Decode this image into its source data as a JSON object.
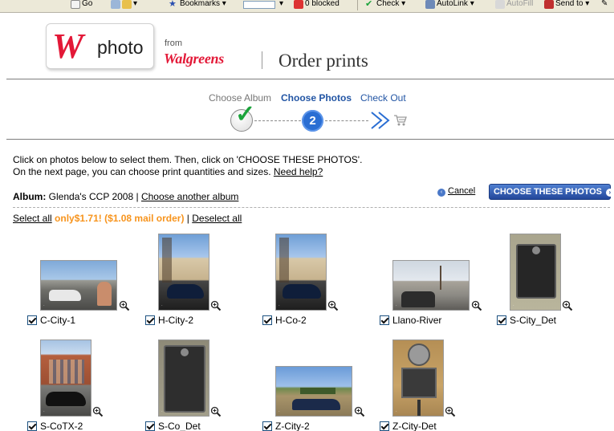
{
  "toolbar": {
    "items": [
      "Go",
      "Bookmarks",
      "0 blocked",
      "Check",
      "AutoLink",
      "AutoFill",
      "Send to"
    ]
  },
  "header": {
    "logo_letter": "W",
    "logo_word": "photo",
    "from": "from",
    "brand": "Walgreens",
    "title": "Order prints"
  },
  "steps": {
    "step1": "Choose Album",
    "step2": "Choose Photos",
    "step3": "Check Out",
    "current_number": "2"
  },
  "instructions": {
    "line1": "Click on photos below to select them. Then, click on 'CHOOSE THESE PHOTOS'.",
    "line2": "On the next page, you can choose print quantities and sizes.",
    "help_link": "Need help?"
  },
  "album": {
    "label": "Album:",
    "name": "Glenda's CCP 2008",
    "separator": "|",
    "change_link": "Choose another album"
  },
  "actions": {
    "cancel": "Cancel",
    "choose": "CHOOSE THESE PHOTOS"
  },
  "selection": {
    "select_all": "Select all",
    "price": "only$1.71! ($1.08 mail order)",
    "separator": "|",
    "deselect_all": "Deselect all"
  },
  "photos": [
    {
      "caption": "C-City-1",
      "checked": true
    },
    {
      "caption": "H-City-2",
      "checked": true
    },
    {
      "caption": "H-Co-2",
      "checked": true
    },
    {
      "caption": "Llano-River",
      "checked": true
    },
    {
      "caption": "S-City_Det",
      "checked": true
    },
    {
      "caption": "S-CoTX-2",
      "checked": true
    },
    {
      "caption": "S-Co_Det",
      "checked": true
    },
    {
      "caption": "Z-City-2",
      "checked": true
    },
    {
      "caption": "Z-City-Det",
      "checked": true
    }
  ],
  "colors": {
    "brand_red": "#e31837",
    "step_blue": "#2255a4",
    "price_orange": "#f7941d",
    "button_blue": "#23479a",
    "check_green": "#1aa33a"
  }
}
